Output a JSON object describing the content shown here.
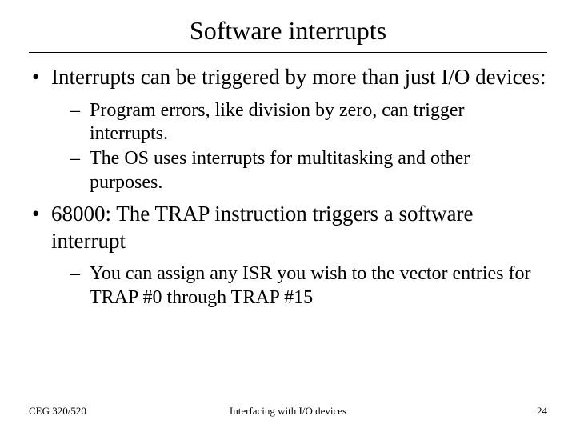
{
  "title": "Software interrupts",
  "bullets": [
    {
      "text": "Interrupts can be triggered by more than just I/O devices:",
      "sub": [
        "Program errors, like division by zero, can trigger interrupts.",
        "The OS uses interrupts for multitasking and other purposes."
      ]
    },
    {
      "text": "68000:  The TRAP instruction triggers a software interrupt",
      "sub": [
        "You can assign any ISR you wish to the vector entries for TRAP #0 through TRAP #15"
      ]
    }
  ],
  "footer": {
    "left": "CEG 320/520",
    "center": "Interfacing with I/O devices",
    "right": "24"
  }
}
